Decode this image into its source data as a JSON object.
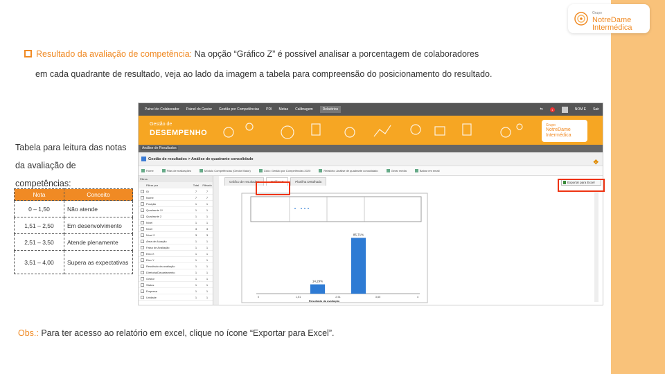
{
  "slide": {
    "bullet_label": "Resultado da avaliação de competência:",
    "bullet_rest": " Na opção “Gráfico Z” é possível analisar a porcentagem de colaboradores",
    "bullet_line2": "em cada quadrante de resultado, veja ao lado da imagem a tabela para compreensão do posicionamento do resultado.",
    "legend_title": "Tabela para leitura das notas da avaliação de competências:",
    "obs_label": "Obs.:",
    "obs_text": " Para ter acesso ao relatório em excel, clique no ícone “Exportar para Excel”.",
    "logo": {
      "grupo": "Grupo",
      "line1": "NotreDame",
      "line2": "Intermédica"
    },
    "colors": {
      "accent": "#f08a24",
      "sidebar": "#f9c27a",
      "banner": "#f6a623"
    }
  },
  "legend": {
    "headers": [
      "Nota",
      "Conceito"
    ],
    "rows": [
      [
        "0 – 1,50",
        "Não atende"
      ],
      [
        "1,51 – 2,50",
        "Em desenvolvimento"
      ],
      [
        "2,51 – 3,50",
        "Atende plenamente"
      ],
      [
        "3,51 – 4,00",
        "Supera as expectativas"
      ]
    ]
  },
  "app": {
    "nav": [
      "Painel do Colaborador",
      "Painel do Gestor",
      "Gestão por Competências",
      "PDI",
      "Metas",
      "Calibragem",
      "Relatórios"
    ],
    "nav_active_index": 6,
    "user": "NOM E",
    "exit": "Sair",
    "notif_count": "1",
    "banner_l1": "Gestão de",
    "banner_l2": "DESEMPENHO",
    "mini_logo": {
      "grupo": "Grupo",
      "line1": "NotreDame",
      "line2": "Intermédica"
    },
    "subbar": "Análise de Resultados",
    "page_title": "Gestão de resultados > Análise de quadrante consolidado",
    "toolbar": [
      "Home",
      "Filas de realizações",
      "Módulo Competências (Gestor Maior)",
      "Ciclo: Gestão por Competências 2020",
      "Relatório: Análise de quadrante consolidado",
      "Gerar média",
      "Baixar em email"
    ],
    "filters": {
      "header": "Filtros",
      "columns": [
        "Filtrar por",
        "Total",
        "Filtrado"
      ],
      "rows": [
        [
          "ID",
          "7",
          "7"
        ],
        [
          "Nome",
          "7",
          "7"
        ],
        [
          "Posição",
          "1",
          "1"
        ],
        [
          "Quadrante X*",
          "1",
          "1"
        ],
        [
          "Quadrante 2",
          "1",
          "1"
        ],
        [
          "Nível",
          "1",
          "1"
        ],
        [
          "Nível",
          "3",
          "3"
        ],
        [
          "Nível 2",
          "3",
          "3"
        ],
        [
          "Área de Atuação",
          "1",
          "1"
        ],
        [
          "Faixa de Avaliação",
          "1",
          "1"
        ],
        [
          "Eixo X",
          "1",
          "1"
        ],
        [
          "Eixo Y",
          "1",
          "1"
        ],
        [
          "Resultado da avaliação",
          "1",
          "1"
        ],
        [
          "Diretoria/Departamento",
          "1",
          "1"
        ],
        [
          "Gestor",
          "1",
          "1"
        ],
        [
          "Status",
          "1",
          "1"
        ],
        [
          "Empresa",
          "1",
          "1"
        ],
        [
          "Unidade",
          "1",
          "1"
        ]
      ]
    },
    "tabs": [
      "Gráfico de resultados",
      "Gráfico Z",
      "Planilha Detalhada"
    ],
    "tab_selected_index": 1,
    "export_label": "Exportar para Excel"
  },
  "chart_data": {
    "type": "bar",
    "categories": [
      "0",
      "1,51",
      "2,51",
      "3,51"
    ],
    "x_tick_labels": [
      "0",
      "1,51",
      "2,51",
      "3,65",
      "4"
    ],
    "values": [
      0,
      14.29,
      85.71,
      0
    ],
    "data_labels": [
      "",
      "14,29%",
      "85,71%",
      ""
    ],
    "xlabel": "Resultado da avaliação",
    "ylabel": "",
    "ylim": [
      0,
      100
    ],
    "bar_color": "#2e7bd4",
    "grid": false
  }
}
